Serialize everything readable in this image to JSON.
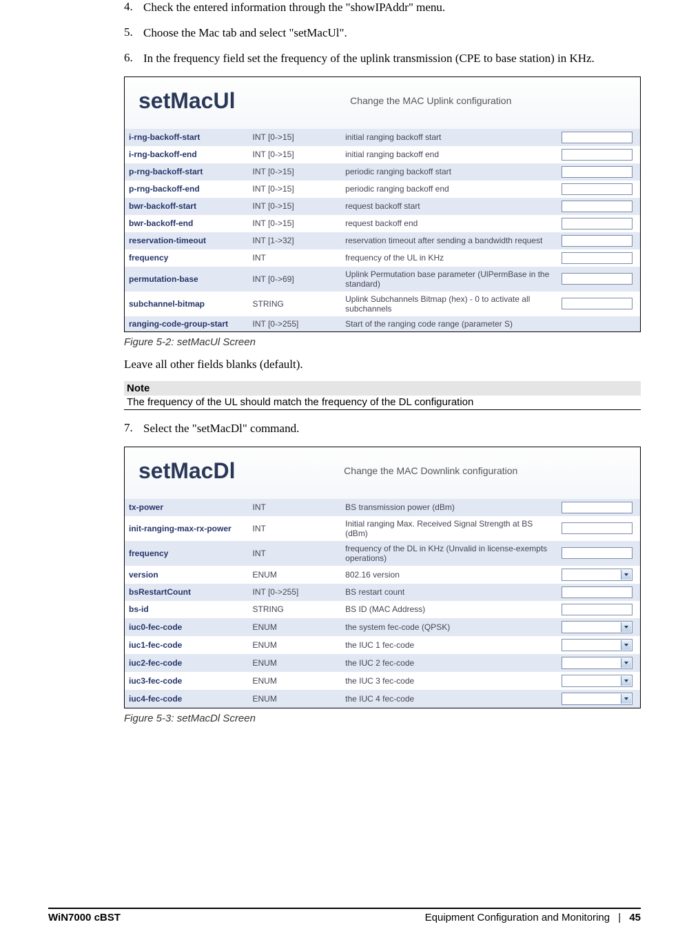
{
  "steps": {
    "s4": {
      "num": "4.",
      "text": "Check the entered information through the \"showIPAddr\" menu."
    },
    "s5": {
      "num": "5.",
      "text": "Choose the Mac tab and select \"setMacUl\"."
    },
    "s6": {
      "num": "6.",
      "text": "In the frequency field set the frequency of the uplink transmission (CPE to base station) in KHz."
    },
    "s7": {
      "num": "7.",
      "text": "Select the \"setMacDl\" command."
    }
  },
  "fig52": {
    "title": "setMacUl",
    "subtitle": "Change the MAC Uplink configuration",
    "caption": "Figure 5-2: setMacUl Screen",
    "rows": [
      {
        "param": "i-rng-backoff-start",
        "type": "INT [0->15]",
        "desc": "initial ranging backoff start",
        "ctrl": "input"
      },
      {
        "param": "i-rng-backoff-end",
        "type": "INT [0->15]",
        "desc": "initial ranging backoff end",
        "ctrl": "input"
      },
      {
        "param": "p-rng-backoff-start",
        "type": "INT [0->15]",
        "desc": "periodic ranging backoff start",
        "ctrl": "input"
      },
      {
        "param": "p-rng-backoff-end",
        "type": "INT [0->15]",
        "desc": "periodic ranging backoff end",
        "ctrl": "input"
      },
      {
        "param": "bwr-backoff-start",
        "type": "INT [0->15]",
        "desc": "request backoff start",
        "ctrl": "input"
      },
      {
        "param": "bwr-backoff-end",
        "type": "INT [0->15]",
        "desc": "request backoff end",
        "ctrl": "input"
      },
      {
        "param": "reservation-timeout",
        "type": "INT [1->32]",
        "desc": "reservation timeout after sending a bandwidth request",
        "ctrl": "input"
      },
      {
        "param": "frequency",
        "type": "INT",
        "desc": "frequency of the UL in KHz",
        "ctrl": "input"
      },
      {
        "param": "permutation-base",
        "type": "INT [0->69]",
        "desc": "Uplink Permutation base parameter (UlPermBase in the standard)",
        "ctrl": "input"
      },
      {
        "param": "subchannel-bitmap",
        "type": "STRING",
        "desc": "Uplink Subchannels Bitmap (hex) - 0 to activate all subchannels",
        "ctrl": "input"
      },
      {
        "param": "ranging-code-group-start",
        "type": "INT [0->255]",
        "desc": "Start of the ranging code range (parameter S)",
        "ctrl": "none"
      }
    ]
  },
  "afterFig52": "Leave all other fields blanks (default).",
  "note": {
    "head": "Note",
    "body": "The frequency of the UL should match the frequency of the DL configuration"
  },
  "fig53": {
    "title": "setMacDl",
    "subtitle": "Change the MAC Downlink configuration",
    "caption": "Figure 5-3: setMacDl Screen",
    "rows": [
      {
        "param": "tx-power",
        "type": "INT",
        "desc": "BS transmission power (dBm)",
        "ctrl": "input"
      },
      {
        "param": "init-ranging-max-rx-power",
        "type": "INT",
        "desc": "Initial ranging Max. Received Signal Strength at BS (dBm)",
        "ctrl": "input"
      },
      {
        "param": "frequency",
        "type": "INT",
        "desc": "frequency of the DL in KHz (Unvalid in license-exempts operations)",
        "ctrl": "input"
      },
      {
        "param": "version",
        "type": "ENUM",
        "desc": "802.16 version",
        "ctrl": "select"
      },
      {
        "param": "bsRestartCount",
        "type": "INT [0->255]",
        "desc": "BS restart count",
        "ctrl": "input"
      },
      {
        "param": "bs-id",
        "type": "STRING",
        "desc": "BS ID (MAC Address)",
        "ctrl": "input"
      },
      {
        "param": "iuc0-fec-code",
        "type": "ENUM",
        "desc": "the system fec-code (QPSK)",
        "ctrl": "select"
      },
      {
        "param": "iuc1-fec-code",
        "type": "ENUM",
        "desc": "the IUC 1 fec-code",
        "ctrl": "select"
      },
      {
        "param": "iuc2-fec-code",
        "type": "ENUM",
        "desc": "the IUC 2 fec-code",
        "ctrl": "select"
      },
      {
        "param": "iuc3-fec-code",
        "type": "ENUM",
        "desc": "the IUC 3 fec-code",
        "ctrl": "select"
      },
      {
        "param": "iuc4-fec-code",
        "type": "ENUM",
        "desc": "the IUC 4 fec-code",
        "ctrl": "select"
      }
    ]
  },
  "footer": {
    "left": "WiN7000 cBST",
    "rightTitle": "Equipment Configuration and Monitoring",
    "sep": "|",
    "page": "45"
  }
}
